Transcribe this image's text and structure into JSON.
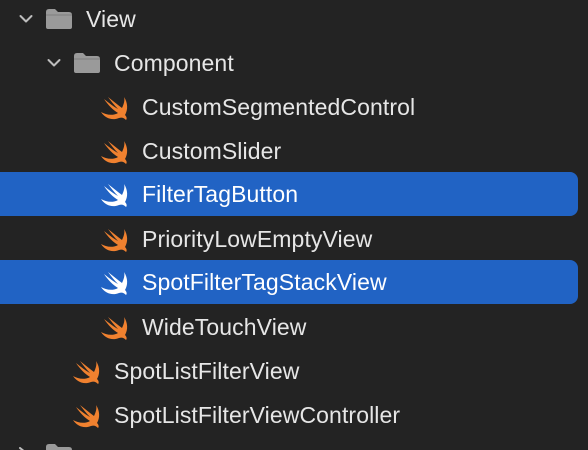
{
  "navigator": {
    "items": [
      {
        "label": "View",
        "kind": "folder",
        "expanded": true,
        "selected": false,
        "icon": "folder-icon"
      },
      {
        "label": "Component",
        "kind": "folder",
        "expanded": true,
        "selected": false,
        "icon": "folder-icon"
      },
      {
        "label": "CustomSegmentedControl",
        "kind": "swift-file",
        "selected": false,
        "icon": "swift-icon"
      },
      {
        "label": "CustomSlider",
        "kind": "swift-file",
        "selected": false,
        "icon": "swift-icon"
      },
      {
        "label": "FilterTagButton",
        "kind": "swift-file",
        "selected": true,
        "icon": "swift-icon"
      },
      {
        "label": "PriorityLowEmptyView",
        "kind": "swift-file",
        "selected": false,
        "icon": "swift-icon"
      },
      {
        "label": "SpotFilterTagStackView",
        "kind": "swift-file",
        "selected": true,
        "icon": "swift-icon"
      },
      {
        "label": "WideTouchView",
        "kind": "swift-file",
        "selected": false,
        "icon": "swift-icon"
      },
      {
        "label": "SpotListFilterView",
        "kind": "swift-file",
        "selected": false,
        "icon": "swift-icon"
      },
      {
        "label": "SpotListFilterViewController",
        "kind": "swift-file",
        "selected": false,
        "icon": "swift-icon"
      }
    ]
  },
  "colors": {
    "background": "#232323",
    "selection": "#2163c4",
    "text": "#e6e6e6",
    "swift_orange": "#f0812f",
    "folder_gray": "#9a9a9a"
  }
}
